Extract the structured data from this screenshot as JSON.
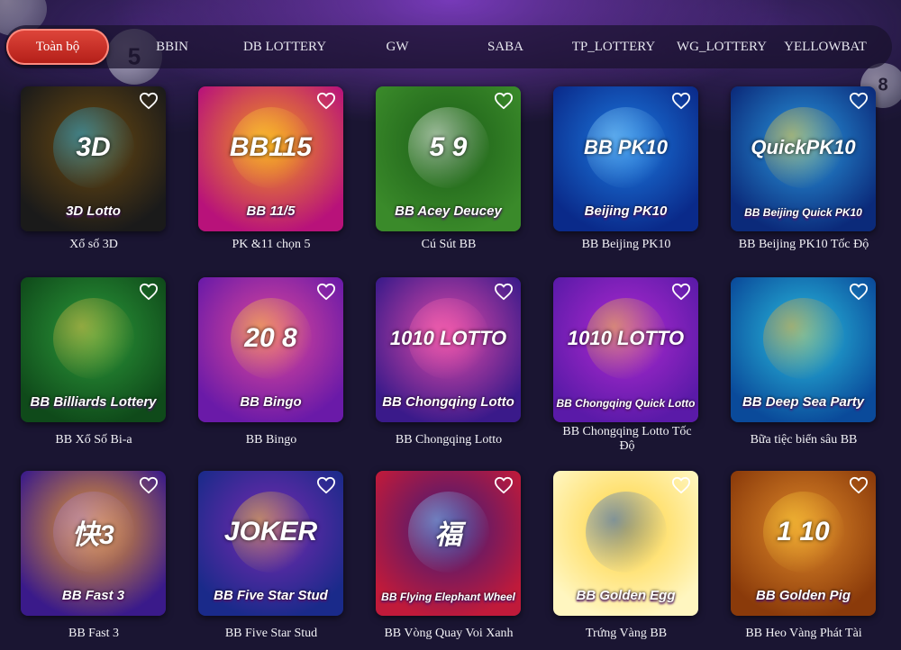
{
  "tabs": [
    {
      "label": "Toàn bộ",
      "active": true
    },
    {
      "label": "BBIN",
      "active": false
    },
    {
      "label": "DB LOTTERY",
      "active": false
    },
    {
      "label": "GW",
      "active": false
    },
    {
      "label": "SABA",
      "active": false
    },
    {
      "label": "TP_LOTTERY",
      "active": false
    },
    {
      "label": "WG_LOTTERY",
      "active": false
    },
    {
      "label": "YELLOWBAT",
      "active": false
    }
  ],
  "background_balls": [
    "5",
    "8"
  ],
  "games": [
    {
      "title": "Xổ số 3D",
      "art_text": "3D",
      "art_caption": "3D Lotto",
      "bg": [
        "#1a1a1a",
        "#6b4a10"
      ],
      "accent": "#2bb5e6"
    },
    {
      "title": "PK &11 chọn 5",
      "art_text": "BB115",
      "art_caption": "BB 11/5",
      "bg": [
        "#b8127a",
        "#f39a1a"
      ],
      "accent": "#ffd23a"
    },
    {
      "title": "Cú Sút BB",
      "art_text": "5  9",
      "art_caption": "BB Acey Deucey",
      "bg": [
        "#3a8a2a",
        "#1b5d17"
      ],
      "accent": "#ffffff"
    },
    {
      "title": "BB Beijing PK10",
      "art_text": "BB PK10",
      "art_caption": "Beijing PK10",
      "bg": [
        "#0a2a8a",
        "#1c7ae0"
      ],
      "accent": "#8fd8ff"
    },
    {
      "title": "BB Beijing PK10 Tốc Độ",
      "art_text": "QuickPK10",
      "art_caption": "BB Beijing Quick PK10",
      "bg": [
        "#0b2a7a",
        "#2a9ae0"
      ],
      "accent": "#ffd23a"
    },
    {
      "title": "BB Xổ Số Bi-a",
      "art_text": "",
      "art_caption": "BB Billiards Lottery",
      "bg": [
        "#0f4a1a",
        "#2c9a3a"
      ],
      "accent": "#e8c04a"
    },
    {
      "title": "BB Bingo",
      "art_text": "20 8",
      "art_caption": "BB Bingo",
      "bg": [
        "#6a1aa8",
        "#e0489a"
      ],
      "accent": "#ffd23a"
    },
    {
      "title": "BB Chongqing Lotto",
      "art_text": "1010 LOTTO",
      "art_caption": "BB Chongqing Lotto",
      "bg": [
        "#3a1a8a",
        "#e04aa8"
      ],
      "accent": "#ff6ab0"
    },
    {
      "title": "BB Chongqing Lotto Tốc Độ",
      "art_text": "1010 LOTTO",
      "art_caption": "BB Chongqing Quick Lotto",
      "bg": [
        "#5a1aa8",
        "#b02ad0"
      ],
      "accent": "#ffd23a"
    },
    {
      "title": "Bữa tiệc biển sâu BB",
      "art_text": "",
      "art_caption": "BB Deep Sea Party",
      "bg": [
        "#0a4a9a",
        "#2ac0e0"
      ],
      "accent": "#ffb02a"
    },
    {
      "title": "BB Fast 3",
      "art_text": "快3",
      "art_caption": "BB Fast 3",
      "bg": [
        "#3a1a8a",
        "#f0a02a"
      ],
      "accent": "#b08ae0"
    },
    {
      "title": "BB Five Star Stud",
      "art_text": "JOKER",
      "art_caption": "BB Five Star Stud",
      "bg": [
        "#1a2a8a",
        "#7a2ab0"
      ],
      "accent": "#ffd23a"
    },
    {
      "title": "BB Vòng Quay Voi Xanh",
      "art_text": "福",
      "art_caption": "BB Flying Elephant Wheel",
      "bg": [
        "#c01a3a",
        "#3a1a7a"
      ],
      "accent": "#8ad0ff"
    },
    {
      "title": "Trứng Vàng BB",
      "art_text": "",
      "art_caption": "BB Golden Egg",
      "bg": [
        "#fff6c0",
        "#ffd23a"
      ],
      "accent": "#1a5ad0"
    },
    {
      "title": "BB Heo Vàng Phát Tài",
      "art_text": "1 10",
      "art_caption": "BB Golden Pig",
      "bg": [
        "#8a3a0a",
        "#e08a2a"
      ],
      "accent": "#ffd23a"
    }
  ]
}
